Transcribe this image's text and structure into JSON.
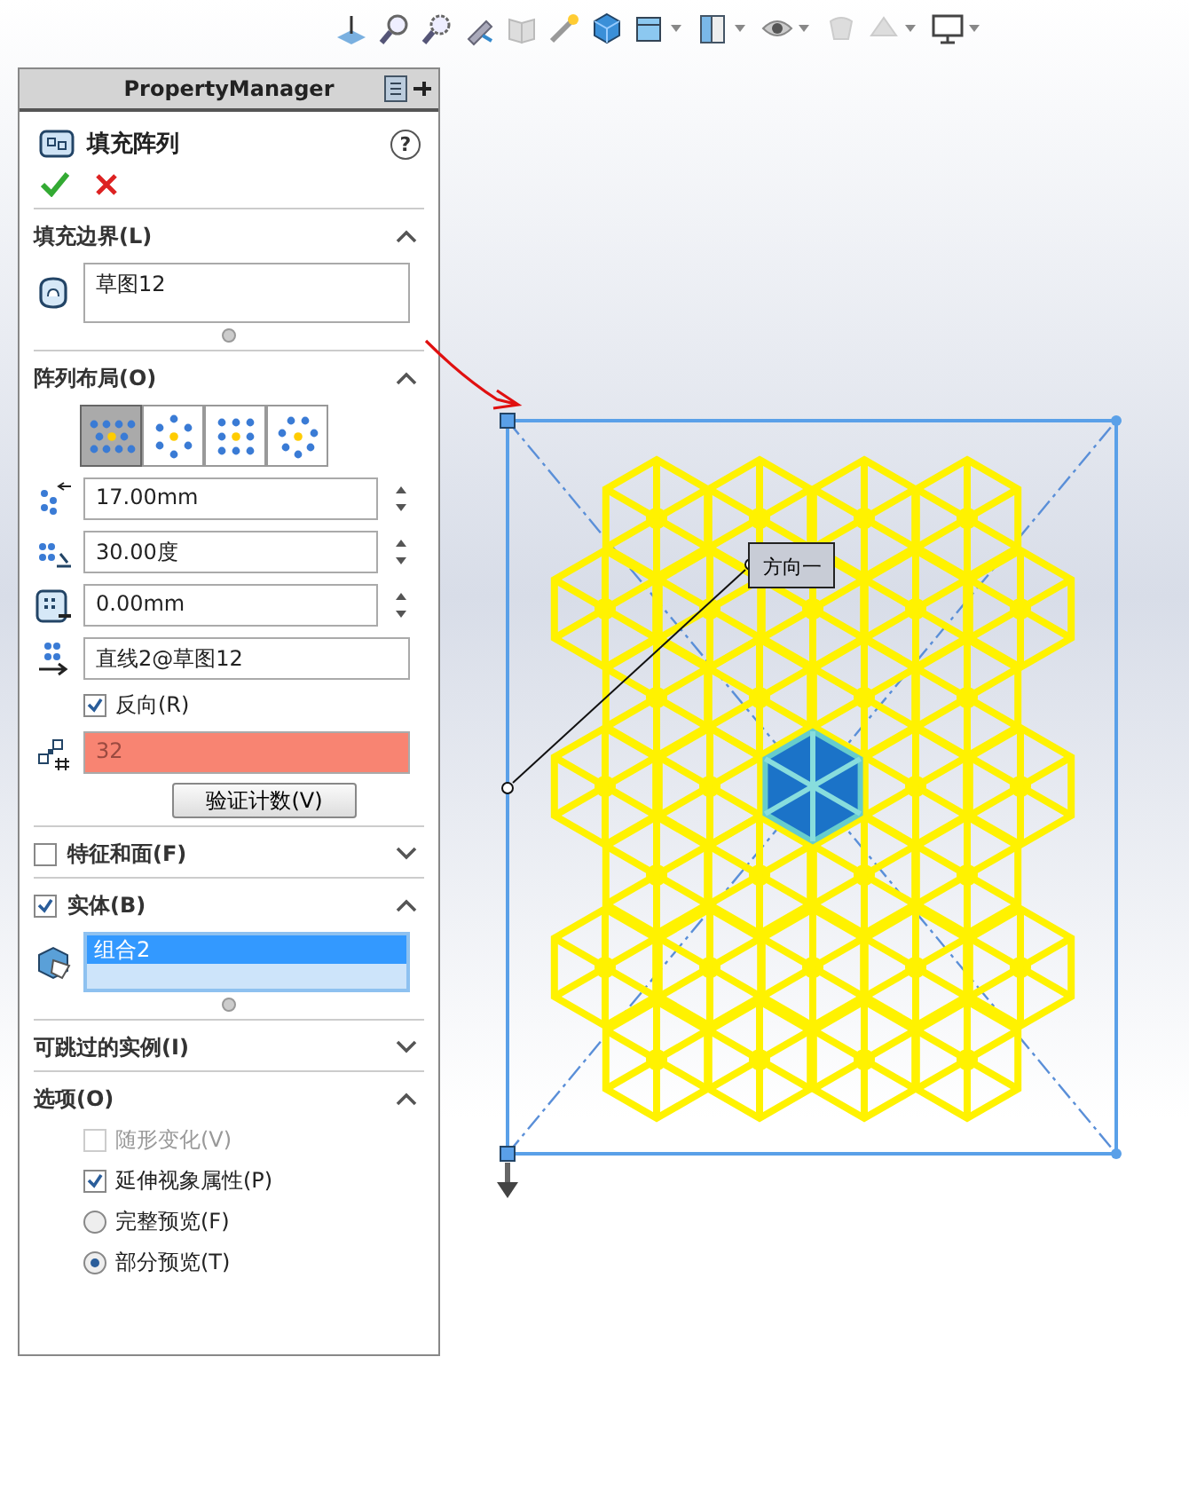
{
  "panel": {
    "title": "PropertyManager",
    "feature_title": "填充阵列",
    "help": "?",
    "fill_boundary": {
      "title": "填充边界(L)",
      "expanded": true,
      "selection": "草图12"
    },
    "pattern_layout": {
      "title": "阵列布局(O)",
      "expanded": true,
      "layouts": [
        {
          "selected": true
        },
        {
          "selected": false
        },
        {
          "selected": false
        },
        {
          "selected": false
        }
      ],
      "spacing": "17.00mm",
      "angle": "30.00度",
      "margin": "0.00mm",
      "direction": "直线2@草图12",
      "reverse": {
        "label": "反向(R)",
        "checked": true
      },
      "count": {
        "value": "32",
        "error": true
      },
      "verify_button": "验证计数(V)"
    },
    "features_faces": {
      "title": "特征和面(F)",
      "checked": false,
      "expanded": false
    },
    "bodies": {
      "title": "实体(B)",
      "checked": true,
      "expanded": true,
      "items": [
        {
          "label": "组合2",
          "selected": true
        }
      ]
    },
    "skip_instances": {
      "title": "可跳过的实例(I)",
      "expanded": false
    },
    "options": {
      "title": "选项(O)",
      "expanded": true,
      "items": [
        {
          "kind": "checkbox",
          "label": "随形变化(V)",
          "checked": false,
          "disabled": true
        },
        {
          "kind": "checkbox",
          "label": "延伸视象属性(P)",
          "checked": true,
          "disabled": false
        },
        {
          "kind": "radio",
          "label": "完整预览(F)",
          "selected": false,
          "disabled": false
        },
        {
          "kind": "radio",
          "label": "部分预览(T)",
          "selected": true,
          "disabled": false
        }
      ]
    }
  },
  "viewport": {
    "callout": "方向一"
  }
}
